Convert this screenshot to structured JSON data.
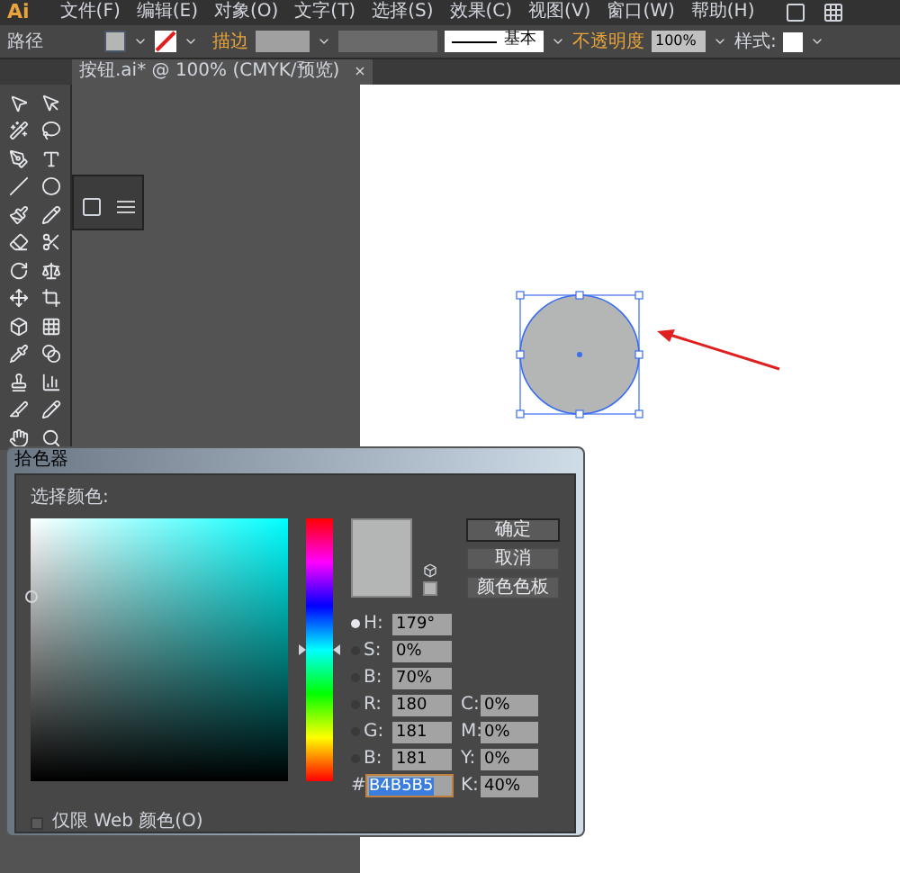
{
  "app": {
    "logo": "Ai"
  },
  "menu": [
    "文件(F)",
    "编辑(E)",
    "对象(O)",
    "文字(T)",
    "选择(S)",
    "效果(C)",
    "视图(V)",
    "窗口(W)",
    "帮助(H)"
  ],
  "control_bar": {
    "selection": "路径",
    "stroke_label": "描边",
    "stroke_style": "基本",
    "opacity_label": "不透明度",
    "opacity": "100%",
    "style_label": "样式:"
  },
  "document_tab": {
    "title": "按钮.ai* @ 100% (CMYK/预览)",
    "close": "×"
  },
  "color_picker": {
    "title": "拾色器",
    "prompt": "选择颜色:",
    "hue_slider": {
      "level": 0.5
    },
    "buttons": [
      "确定",
      "取消",
      "颜色色板"
    ],
    "fields": [
      {
        "label": "H:",
        "value": "179°",
        "selected": true
      },
      {
        "label": "S:",
        "value": "0%",
        "selected": false
      },
      {
        "label": "B:",
        "value": "70%",
        "selected": false
      },
      {
        "label": "R:",
        "value": "180",
        "selected": false
      },
      {
        "label": "G:",
        "value": "181",
        "selected": false
      },
      {
        "label": "B:",
        "value": "181",
        "selected": false
      }
    ],
    "cmyk": [
      {
        "label": "C:",
        "value": "0%"
      },
      {
        "label": "M:",
        "value": "0%"
      },
      {
        "label": "Y:",
        "value": "0%"
      },
      {
        "label": "K:",
        "value": "40%"
      }
    ],
    "hex": {
      "label": "#",
      "value": "B4B5B5",
      "highlighted": true
    },
    "web_only": {
      "label": "仅限 Web 颜色(O)",
      "checked": false
    }
  }
}
